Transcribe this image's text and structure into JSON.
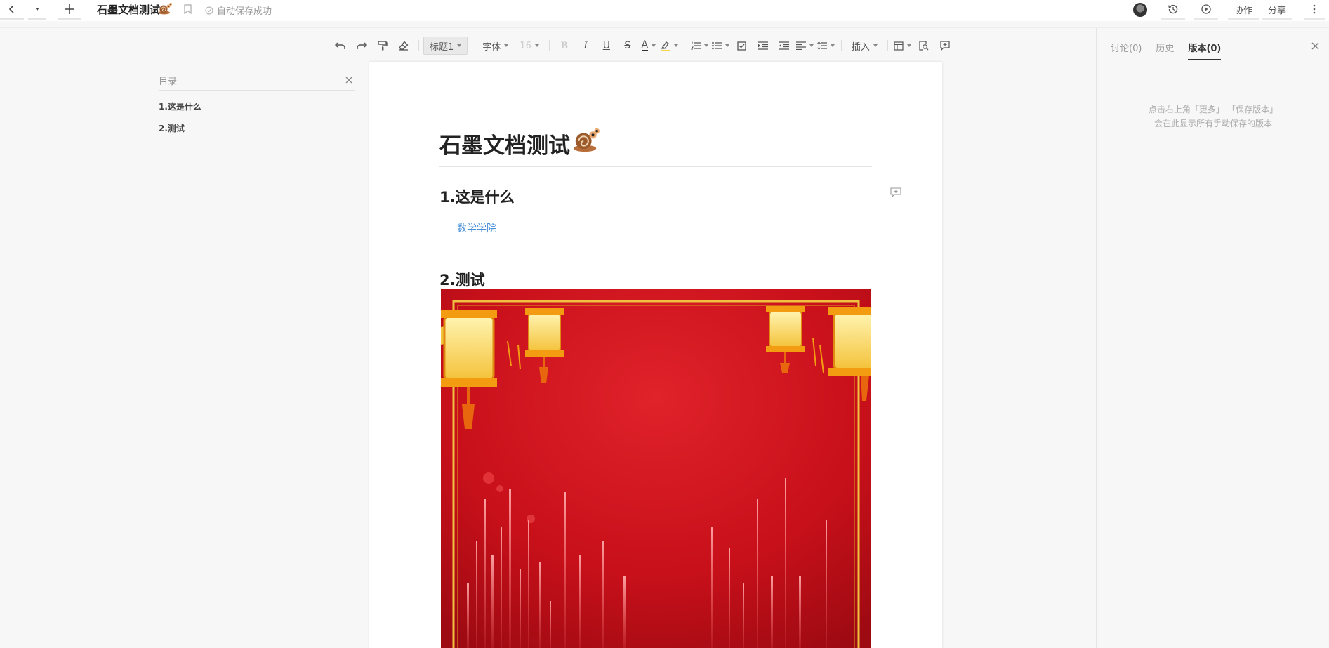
{
  "header": {
    "doc_title": "石墨文档测试",
    "save_status": "自动保存成功",
    "collaborate_label": "协作",
    "share_label": "分享"
  },
  "toolbar": {
    "heading_style": "标题1",
    "font": "字体",
    "font_size": "16",
    "insert_label": "插入"
  },
  "toc": {
    "title": "目录",
    "items": [
      "1.这是什么",
      "2.测试"
    ]
  },
  "document": {
    "title": "石墨文档测试",
    "sections": [
      {
        "heading": "1.这是什么",
        "task_text": "数学学院",
        "task_checked": false
      },
      {
        "heading": "2.测试"
      }
    ]
  },
  "right_panel": {
    "tabs": [
      "讨论(0)",
      "历史",
      "版本(0)"
    ],
    "active_tab": "版本(0)",
    "empty_line1": "点击右上角「更多」-「保存版本」",
    "empty_line2": "会在此显示所有手动保存的版本"
  },
  "colors": {
    "link": "#4a90d9",
    "festive_red": "#c8101a",
    "gold": "#f0c040"
  }
}
